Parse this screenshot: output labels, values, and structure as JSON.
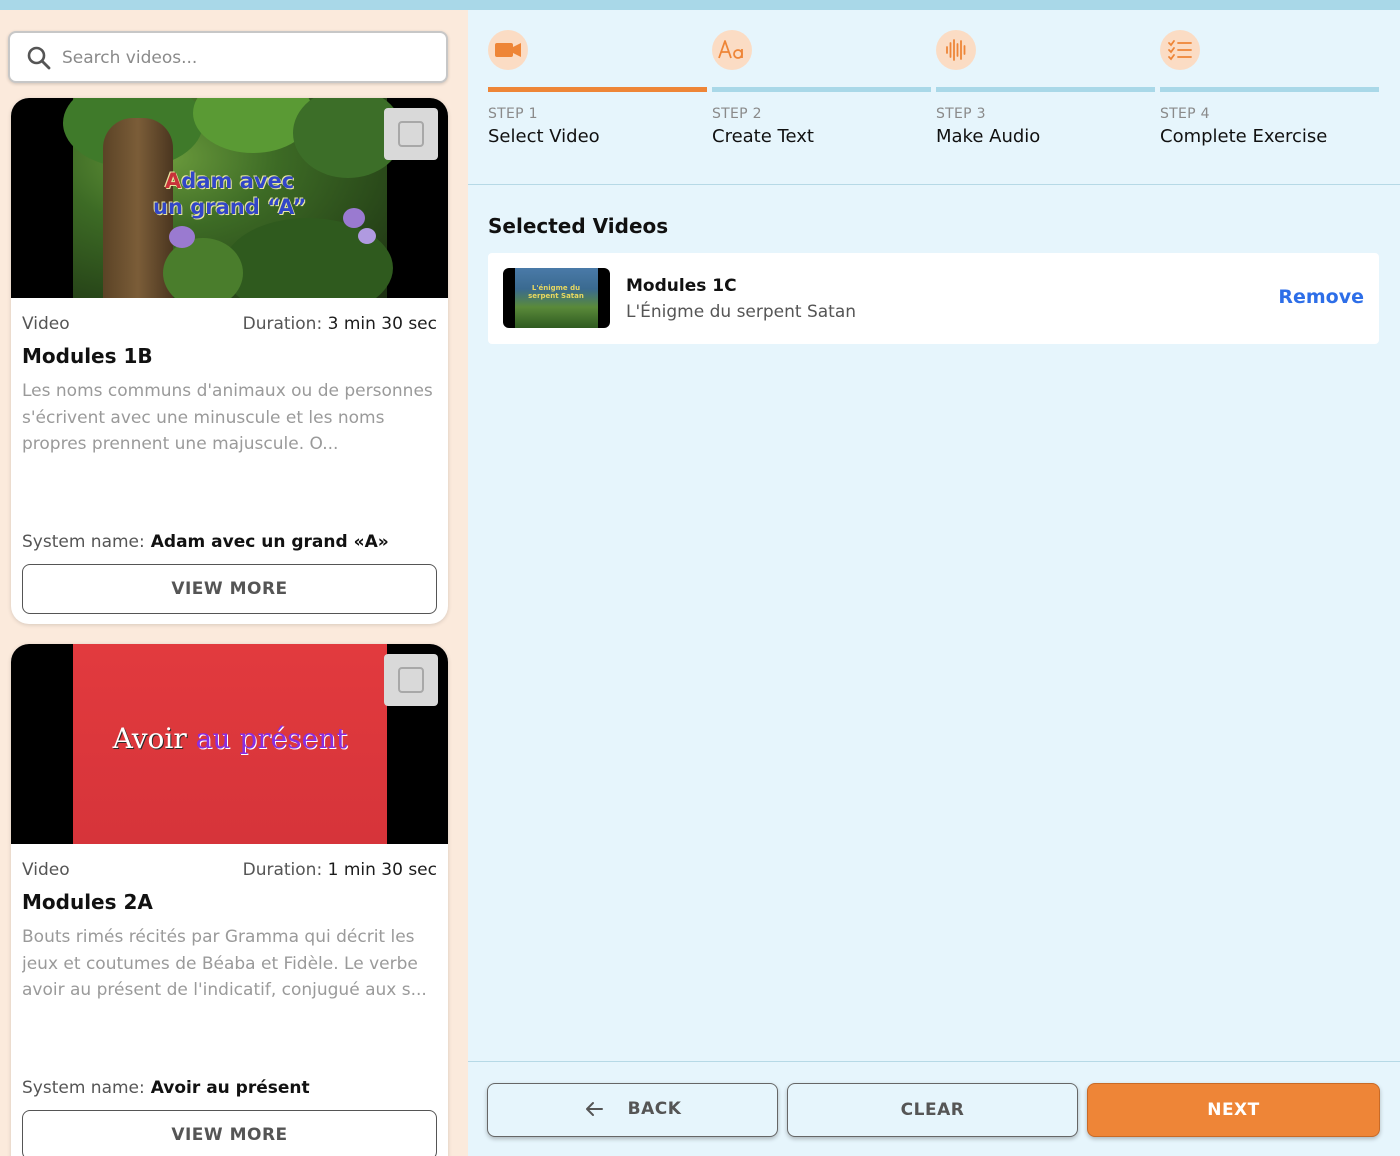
{
  "colors": {
    "accent": "#ee8537",
    "link": "#2d6ee8",
    "step_track": "#a9d8e8"
  },
  "search": {
    "placeholder": "Search videos..."
  },
  "videos": [
    {
      "type_label": "Video",
      "duration_label": "Duration:",
      "duration_value": "3 min 30 sec",
      "title": "Modules 1B",
      "description": "Les noms communs d'animaux ou de personnes s'écrivent avec une minuscule et les noms propres prennent une majuscule. O...",
      "system_name_label": "System name:",
      "system_name": "Adam avec un grand «A»",
      "thumb_line1_red": "A",
      "thumb_line1_rest": "dam avec",
      "thumb_line2": "un grand “A”",
      "view_more": "VIEW MORE"
    },
    {
      "type_label": "Video",
      "duration_label": "Duration:",
      "duration_value": "1 min 30 sec",
      "title": "Modules 2A",
      "description": "Bouts rimés récités par Gramma qui décrit les jeux et coutumes de Béaba et Fidèle. Le verbe avoir au présent de l'indicatif, conjugué aux s...",
      "system_name_label": "System name:",
      "system_name": "Avoir au présent",
      "thumb_word1": "Avoir",
      "thumb_word2": "au présent",
      "view_more": "VIEW MORE"
    }
  ],
  "steps": [
    {
      "num": "STEP 1",
      "label": "Select Video",
      "icon": "video-camera-icon",
      "active": true
    },
    {
      "num": "STEP 2",
      "label": "Create Text",
      "icon": "text-aa-icon",
      "active": false
    },
    {
      "num": "STEP 3",
      "label": "Make Audio",
      "icon": "audio-waveform-icon",
      "active": false
    },
    {
      "num": "STEP 4",
      "label": "Complete Exercise",
      "icon": "checklist-icon",
      "active": false
    }
  ],
  "selected": {
    "heading": "Selected Videos",
    "items": [
      {
        "title": "Modules 1C",
        "subtitle": "L'Énigme du serpent Satan",
        "thumb_text": "L'énigme du serpent Satan",
        "remove_label": "Remove"
      }
    ]
  },
  "footer": {
    "back": "BACK",
    "clear": "CLEAR",
    "next": "NEXT"
  }
}
